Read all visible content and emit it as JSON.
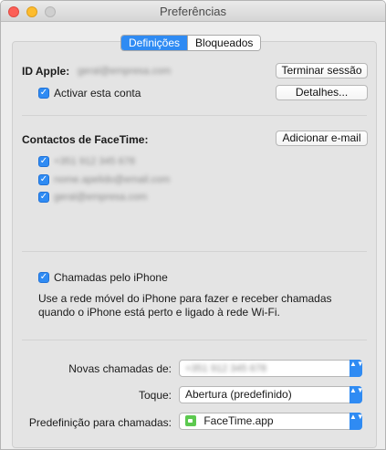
{
  "window": {
    "title": "Preferências"
  },
  "tabs": [
    {
      "label": "Definições",
      "active": true
    },
    {
      "label": "Bloqueados",
      "active": false
    }
  ],
  "apple_id": {
    "label": "ID Apple:",
    "value": "geral@empresa.com",
    "sign_out_button": "Terminar sessão",
    "enable_checkbox": {
      "label": "Activar esta conta",
      "checked": true
    },
    "details_button": "Detalhes..."
  },
  "facetime_contacts": {
    "label": "Contactos de FaceTime:",
    "add_email_button": "Adicionar e-mail",
    "items": [
      {
        "value": "+351 912 345 678",
        "checked": true
      },
      {
        "value": "nome.apelido@email.com",
        "checked": true
      },
      {
        "value": "geral@empresa.com",
        "checked": true
      }
    ]
  },
  "iphone_calls": {
    "checkbox_label": "Chamadas pelo iPhone",
    "checked": true,
    "description_line1": "Use a rede móvel do iPhone para fazer e receber chamadas",
    "description_line2": "quando o iPhone está perto e ligado à rede Wi-Fi."
  },
  "settings": {
    "new_calls_label": "Novas chamadas de:",
    "new_calls_value": "+351 912 345 678",
    "ringtone_label": "Toque:",
    "ringtone_value": "Abertura (predefinido)",
    "default_app_label": "Predefinição para chamadas:",
    "default_app_value": "FaceTime.app"
  },
  "colors": {
    "accent": "#2f8bf3"
  },
  "icons": {
    "check": "✓",
    "popup_arrows": "▲▼",
    "facetime_app": "facetime-app-icon"
  }
}
